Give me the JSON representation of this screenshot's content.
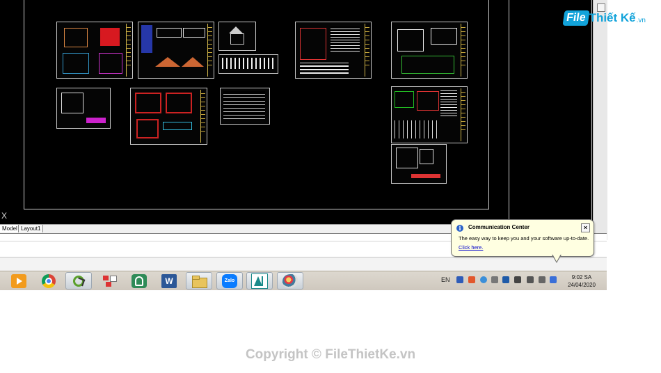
{
  "cad": {
    "ucs_label": "X",
    "tabs": [
      {
        "label": "Model",
        "active": true
      },
      {
        "label": "Layout1",
        "active": false
      }
    ]
  },
  "notification": {
    "title": "Communication Center",
    "message": "The easy way to keep you and your software up-to-date.",
    "link": "Click here.",
    "close_label": "×"
  },
  "taskbar": {
    "apps": [
      {
        "name": "media-player-icon",
        "active": false
      },
      {
        "name": "chrome-icon",
        "active": false
      },
      {
        "name": "snipping-tool-icon",
        "active": true
      },
      {
        "name": "app-grid-icon",
        "active": false
      },
      {
        "name": "vpn-app-icon",
        "active": false
      },
      {
        "name": "word-icon",
        "active": false
      },
      {
        "name": "file-explorer-icon",
        "active": true
      },
      {
        "name": "zalo-icon",
        "active": true
      },
      {
        "name": "autocad-icon",
        "active": true
      },
      {
        "name": "paint-icon",
        "active": true
      }
    ],
    "zalo_label": "Zalo",
    "word_label": "W",
    "language": "EN",
    "clock_time": "9:02 SA",
    "clock_date": "24/04/2020"
  },
  "watermark": {
    "logo_file": "File",
    "logo_rest": "Thiết Kế",
    "logo_domain": ".vn",
    "copyright": "Copyright © FileThietKe.vn"
  },
  "colors": {
    "cad_background": "#000000",
    "balloon_background": "#ffffe1",
    "logo_blue": "#12a3da",
    "watermark_gray": "#c4c4c4"
  }
}
